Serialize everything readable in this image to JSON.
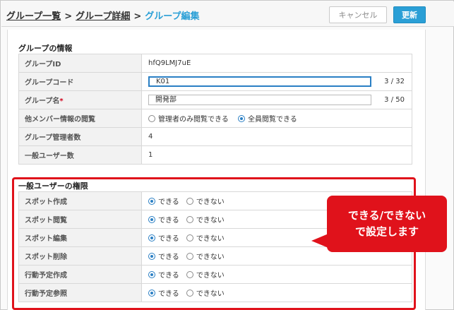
{
  "breadcrumb": {
    "items": [
      "グループ一覧",
      "グループ詳細"
    ],
    "separator": ">",
    "current": "グループ編集"
  },
  "buttons": {
    "cancel": "キャンセル",
    "update": "更新"
  },
  "group_info": {
    "title": "グループの情報",
    "rows": {
      "group_id": {
        "label": "グループID",
        "value": "hfQ9LMJ7uE"
      },
      "group_code": {
        "label": "グループコード",
        "value": "K01",
        "count": "3 / 32"
      },
      "group_name": {
        "label": "グループ名",
        "required_mark": "*",
        "value": "開発部",
        "count": "3 / 50"
      },
      "member_view": {
        "label": "他メンバー情報の閲覧",
        "option_admin": "管理者のみ閲覧できる",
        "option_all": "全員閲覧できる",
        "selected": "option_all"
      },
      "admin_count": {
        "label": "グループ管理者数",
        "value": "4"
      },
      "general_count": {
        "label": "一般ユーザー数",
        "value": "1"
      }
    }
  },
  "permissions": {
    "title": "一般ユーザーの権限",
    "option_yes": "できる",
    "option_no": "できない",
    "rows": [
      {
        "label": "スポット作成",
        "selected": "yes"
      },
      {
        "label": "スポット閲覧",
        "selected": "yes"
      },
      {
        "label": "スポット編集",
        "selected": "yes"
      },
      {
        "label": "スポット削除",
        "selected": "yes"
      },
      {
        "label": "行動予定作成",
        "selected": "yes"
      },
      {
        "label": "行動予定参照",
        "selected": "yes"
      }
    ]
  },
  "callout": {
    "line1": "できる/できない",
    "line2": "で設定します"
  },
  "colors": {
    "accent": "#2a9fd6",
    "annotation": "#e0121b"
  }
}
